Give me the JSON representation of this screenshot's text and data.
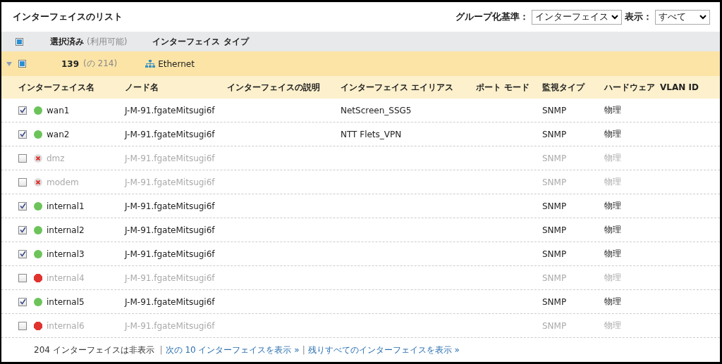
{
  "title": "インターフェイスのリスト",
  "group_by": {
    "label": "グループ化基準：",
    "value": "インターフェイス"
  },
  "show": {
    "label": "表示：",
    "value": "すべて"
  },
  "header": {
    "checked": true,
    "selected_label": "選択済み",
    "available_label": "(利用可能)",
    "type_label": "インターフェイス タイプ"
  },
  "group": {
    "expanded": true,
    "checked": true,
    "selected_count": "139",
    "available_count": "(の 214)",
    "type": "Ethernet"
  },
  "columns": [
    "インターフェイス名",
    "ノード名",
    "インターフェイスの説明",
    "インターフェイス エイリアス",
    "ポート モード",
    "監視タイプ",
    "ハードウェア",
    "VLAN ID"
  ],
  "rows": [
    {
      "checked": true,
      "kind": "up",
      "name": "wan1",
      "node": "J-M-91.fgateMitsugi6f",
      "alias": "NetScreen_SSG5",
      "monitor": "SNMP",
      "hardware": "物理"
    },
    {
      "checked": true,
      "kind": "up",
      "name": "wan2",
      "node": "J-M-91.fgateMitsugi6f",
      "alias": "NTT Flets_VPN",
      "monitor": "SNMP",
      "hardware": "物理"
    },
    {
      "checked": false,
      "kind": "unmanaged",
      "name": "dmz",
      "node": "J-M-91.fgateMitsugi6f",
      "monitor": "SNMP",
      "hardware": "物理"
    },
    {
      "checked": false,
      "kind": "unmanaged",
      "name": "modem",
      "node": "J-M-91.fgateMitsugi6f",
      "monitor": "SNMP",
      "hardware": "物理"
    },
    {
      "checked": true,
      "kind": "up",
      "name": "internal1",
      "node": "J-M-91.fgateMitsugi6f",
      "monitor": "SNMP",
      "hardware": "物理"
    },
    {
      "checked": true,
      "kind": "up",
      "name": "internal2",
      "node": "J-M-91.fgateMitsugi6f",
      "monitor": "SNMP",
      "hardware": "物理"
    },
    {
      "checked": true,
      "kind": "up",
      "name": "internal3",
      "node": "J-M-91.fgateMitsugi6f",
      "monitor": "SNMP",
      "hardware": "物理"
    },
    {
      "checked": false,
      "kind": "down",
      "name": "internal4",
      "node": "J-M-91.fgateMitsugi6f",
      "monitor": "SNMP",
      "hardware": "物理"
    },
    {
      "checked": true,
      "kind": "up",
      "name": "internal5",
      "node": "J-M-91.fgateMitsugi6f",
      "monitor": "SNMP",
      "hardware": "物理"
    },
    {
      "checked": false,
      "kind": "down",
      "name": "internal6",
      "node": "J-M-91.fgateMitsugi6f",
      "monitor": "SNMP",
      "hardware": "物理"
    }
  ],
  "footer": {
    "hidden_text": "204 インターフェイスは非表示",
    "separator": "|",
    "links": [
      "次の 10 インターフェイスを表示 »",
      "残りすべてのインターフェイスを表示 »"
    ]
  }
}
